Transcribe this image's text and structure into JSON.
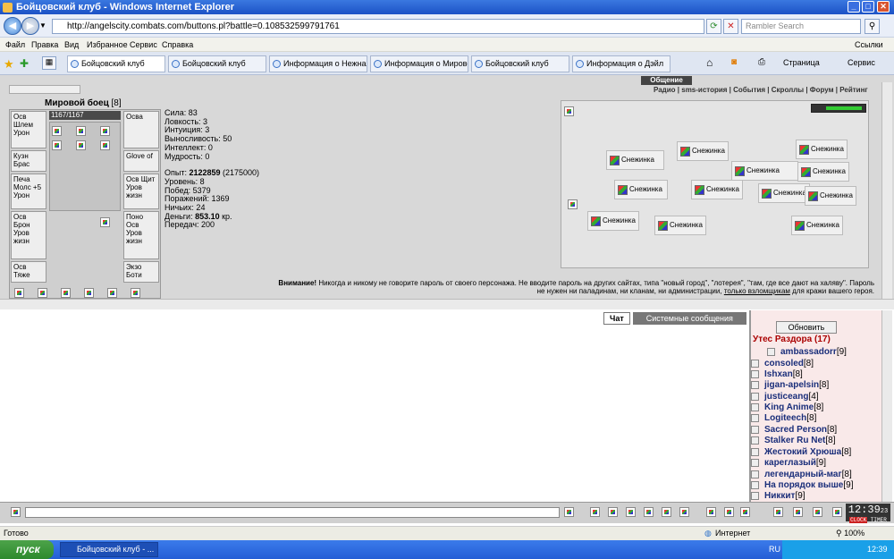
{
  "window": {
    "title": "Бойцовский клуб - Windows Internet Explorer"
  },
  "address": {
    "url": "http://angelscity.combats.com/buttons.pl?battle=0.108532599791761",
    "search_placeholder": "Rambler Search"
  },
  "menu": [
    "Файл",
    "Правка",
    "Вид",
    "Избранное",
    "Сервис",
    "Справка"
  ],
  "links_label": "Ссылки",
  "tabs": [
    "Бойцовский клуб",
    "Бойцовский клуб",
    "Информация о Нежная н...",
    "Информация о Мировой ...",
    "Бойцовский клуб",
    "Информация о Дэйл"
  ],
  "toolbar": {
    "page": "Страница",
    "service": "Сервис"
  },
  "character": {
    "name": "Мировой боец",
    "level": "[8]",
    "hp": "1167/1167"
  },
  "slots": {
    "a": "Осв Шлем Урон",
    "b": "Кузн Брас",
    "c": "Печа Молс +5 Урон",
    "d": "Осв Брон Уров жизн",
    "e": "Осв Тяже",
    "f": "Осва",
    "g": "Glove of",
    "h": "Осв Щит Уров жизн",
    "i": "Поно Осв Уров жизн",
    "j": "Экзо Боти"
  },
  "stats": {
    "strength": "Сила: 83",
    "agility": "Ловкость: 3",
    "intuition": "Интуиция: 3",
    "endurance": "Выносливость: 50",
    "intellect": "Интеллект: 0",
    "wisdom": "Мудрость: 0",
    "exp_label": "Опыт: ",
    "exp": "2122859",
    "exp_next": " (2175000)",
    "level": "Уровень: 8",
    "wins": "Побед: 5379",
    "losses": "Поражений: 1369",
    "draws": "Ничьих: 24",
    "money_label": "Деньги: ",
    "money": "853.10",
    "money_unit": " кр.",
    "transfers": "Передач: 200"
  },
  "nav": {
    "tab": "Общение",
    "links": "Радио | sms-история | События | Скроллы | Форум | Рейтинг"
  },
  "arena": {
    "mob": "Снежинка"
  },
  "warning": {
    "bold": "Внимание!",
    "text": "Никогда и никому не говорите пароль от своего персонажа. Не вводите пароль на других сайтах, типа \"новый город\", \"лотерея\", \"там, где все дают на халяву\". Пароль не нужен ни паладинам, ни кланам, ни администрации,",
    "link": "только взломщикам",
    "tail": " для кражи вашего героя."
  },
  "chat": {
    "tab1": "Чат",
    "tab2": "Системные сообщения"
  },
  "sidebar": {
    "refresh": "Обновить",
    "location": "Утес Раздора (17)",
    "users": [
      {
        "name": "ambassadorr",
        "lvl": "[9]"
      },
      {
        "name": "consoled",
        "lvl": "[8]"
      },
      {
        "name": "Ishxan",
        "lvl": "[8]"
      },
      {
        "name": "jigan-apelsin",
        "lvl": "[8]"
      },
      {
        "name": "justiceang",
        "lvl": "[4]"
      },
      {
        "name": "King Anime",
        "lvl": "[8]"
      },
      {
        "name": "Logiteech",
        "lvl": "[8]"
      },
      {
        "name": "Sacred Person",
        "lvl": "[8]"
      },
      {
        "name": "Stalker Ru Net",
        "lvl": "[8]"
      },
      {
        "name": "Жестокий Хрюша",
        "lvl": "[8]"
      },
      {
        "name": "кареглазый",
        "lvl": "[9]"
      },
      {
        "name": "легендарный-маг",
        "lvl": "[8]"
      },
      {
        "name": "На порядок выше",
        "lvl": "[9]"
      },
      {
        "name": "Никкит",
        "lvl": "[9]"
      }
    ]
  },
  "clock": {
    "time": "12:39",
    "sec": "23",
    "l1": "CLOCK",
    "l2": "TIMER"
  },
  "status": {
    "ready": "Готово",
    "zone": "Интернет",
    "zoom": "100%"
  },
  "taskbar": {
    "start": "пуск",
    "task": "Бойцовский клуб - ...",
    "lang": "RU",
    "time": "12:39"
  }
}
